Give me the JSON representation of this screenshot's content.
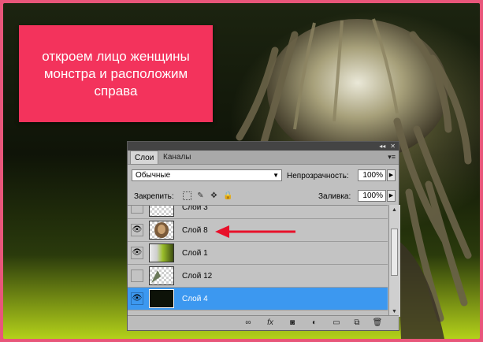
{
  "banner": {
    "text": "откроем лицо женщины\nмонстра и расположим\nсправа"
  },
  "panel": {
    "tabs": [
      {
        "label": "Слои"
      },
      {
        "label": "Каналы"
      }
    ],
    "tab_menu_icon": "panel-menu-icon",
    "blend_mode": "Обычные",
    "opacity_label": "Непрозрачность:",
    "opacity_value": "100%",
    "lock_label": "Закрепить:",
    "fill_label": "Заливка:",
    "fill_value": "100%",
    "layers": [
      {
        "name": "Слой 3",
        "visible": false
      },
      {
        "name": "Слой 8",
        "visible": true
      },
      {
        "name": "Слой 1",
        "visible": true
      },
      {
        "name": "Слой 12",
        "visible": false
      },
      {
        "name": "Слой 4",
        "visible": true,
        "selected": true
      }
    ],
    "bottom_icons": [
      "link-icon",
      "fx-icon",
      "mask-icon",
      "adjustment-icon",
      "group-folder-icon",
      "new-layer-icon",
      "trash-icon"
    ]
  },
  "colors": {
    "banner": "#f3335c",
    "selected_layer": "#3c98f0",
    "arrow": "#e8102a",
    "frame": "#e8567a"
  }
}
